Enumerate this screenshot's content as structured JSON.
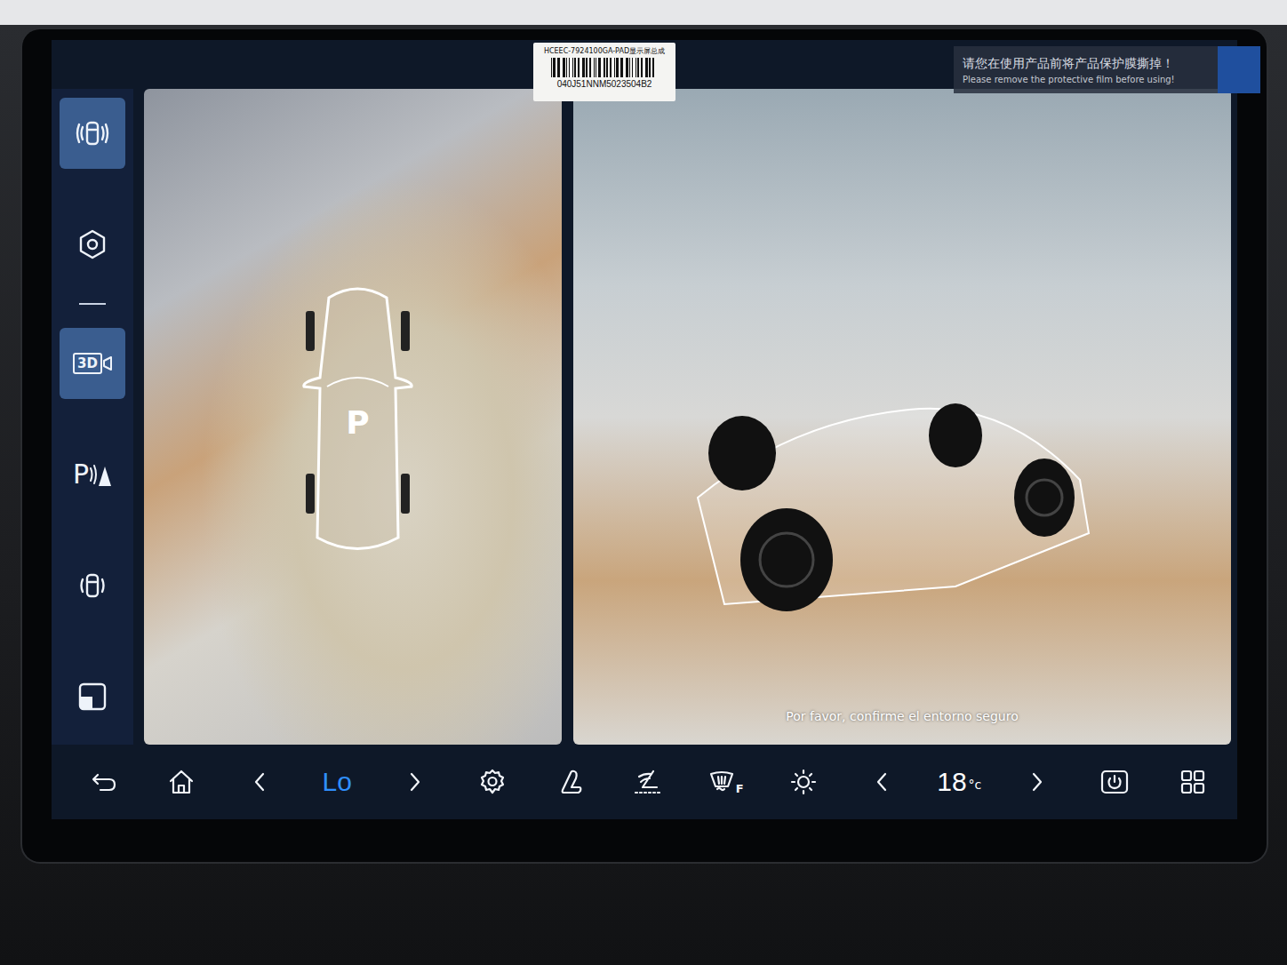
{
  "stickers": {
    "barcode": {
      "part": "HCEEC-7924100GA-PAD显示屏总成",
      "serial": "040J51NNM5023504B2"
    },
    "film": {
      "zh": "请您在使用产品前将产品保护膜撕掉！",
      "en": "Please remove the protective film before using!"
    }
  },
  "sidebar": {
    "items": [
      {
        "kind": "surround",
        "selected": true
      },
      {
        "kind": "hexagon",
        "selected": false
      },
      {
        "kind": "divider",
        "selected": false
      },
      {
        "kind": "camera",
        "label": "3D",
        "selected": true
      },
      {
        "kind": "radar",
        "label": "P",
        "selected": false
      },
      {
        "kind": "car",
        "selected": false
      },
      {
        "kind": "square",
        "selected": false
      }
    ]
  },
  "views": {
    "top": {
      "gear": "P"
    },
    "perspective": {
      "prompt": "Por favor, confirme el entorno seguro"
    }
  },
  "bottom_bar": {
    "items": [
      {
        "kind": "back"
      },
      {
        "kind": "home"
      },
      {
        "kind": "left"
      },
      {
        "kind": "value",
        "text": "Lo",
        "color": "#2f8fff"
      },
      {
        "kind": "right"
      },
      {
        "kind": "gear"
      },
      {
        "kind": "seat"
      },
      {
        "kind": "recline"
      },
      {
        "kind": "defrost",
        "label": "F"
      },
      {
        "kind": "brightness"
      },
      {
        "kind": "left"
      },
      {
        "kind": "temp",
        "text": "18",
        "unit": "°c",
        "color": "#ffffff"
      },
      {
        "kind": "right"
      },
      {
        "kind": "power"
      },
      {
        "kind": "apps"
      }
    ]
  }
}
